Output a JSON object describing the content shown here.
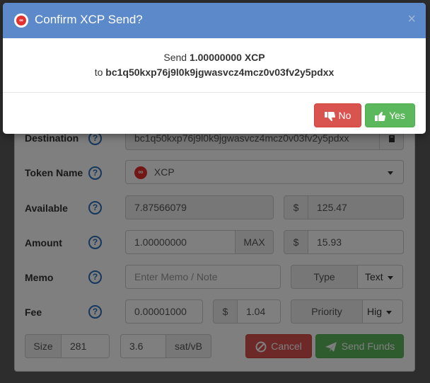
{
  "modal": {
    "title": "Confirm XCP Send?",
    "close_glyph": "×",
    "send_prefix": "Send ",
    "amount_text": "1.00000000 XCP",
    "to_prefix": "to ",
    "address": "bc1q50kxp76j9l0k9jgwasvcz4mcz0v03fv2y5pdxx",
    "no_label": "No",
    "yes_label": "Yes",
    "no_icon": "thumbs-down-icon",
    "yes_icon": "thumbs-up-icon"
  },
  "form": {
    "destination": {
      "label": "Destination",
      "value": "bc1q50kxp76j9l0k9jgwasvcz4mcz0v03fv2y5pdxx"
    },
    "token": {
      "label": "Token Name",
      "value": "XCP"
    },
    "available": {
      "label": "Available",
      "value": "7.87566079",
      "currency": "$",
      "usd": "125.47"
    },
    "amount": {
      "label": "Amount",
      "value": "1.00000000",
      "max_label": "MAX",
      "currency": "$",
      "usd": "15.93"
    },
    "memo": {
      "label": "Memo",
      "placeholder": "Enter Memo / Note",
      "type_label": "Type",
      "type_value": "Text"
    },
    "fee": {
      "label": "Fee",
      "value": "0.00001000",
      "currency": "$",
      "usd": "1.04",
      "priority_label": "Priority",
      "priority_value": "Hig"
    },
    "size": {
      "label": "Size",
      "value": "281"
    },
    "rate": {
      "value": "3.6",
      "unit": "sat/vB"
    },
    "cancel_label": "Cancel",
    "send_label": "Send Funds",
    "help_glyph": "?"
  },
  "colors": {
    "header": "#5b89c9",
    "danger": "#d9534f",
    "success": "#5cb85c",
    "xcp_red": "#e2312f"
  }
}
